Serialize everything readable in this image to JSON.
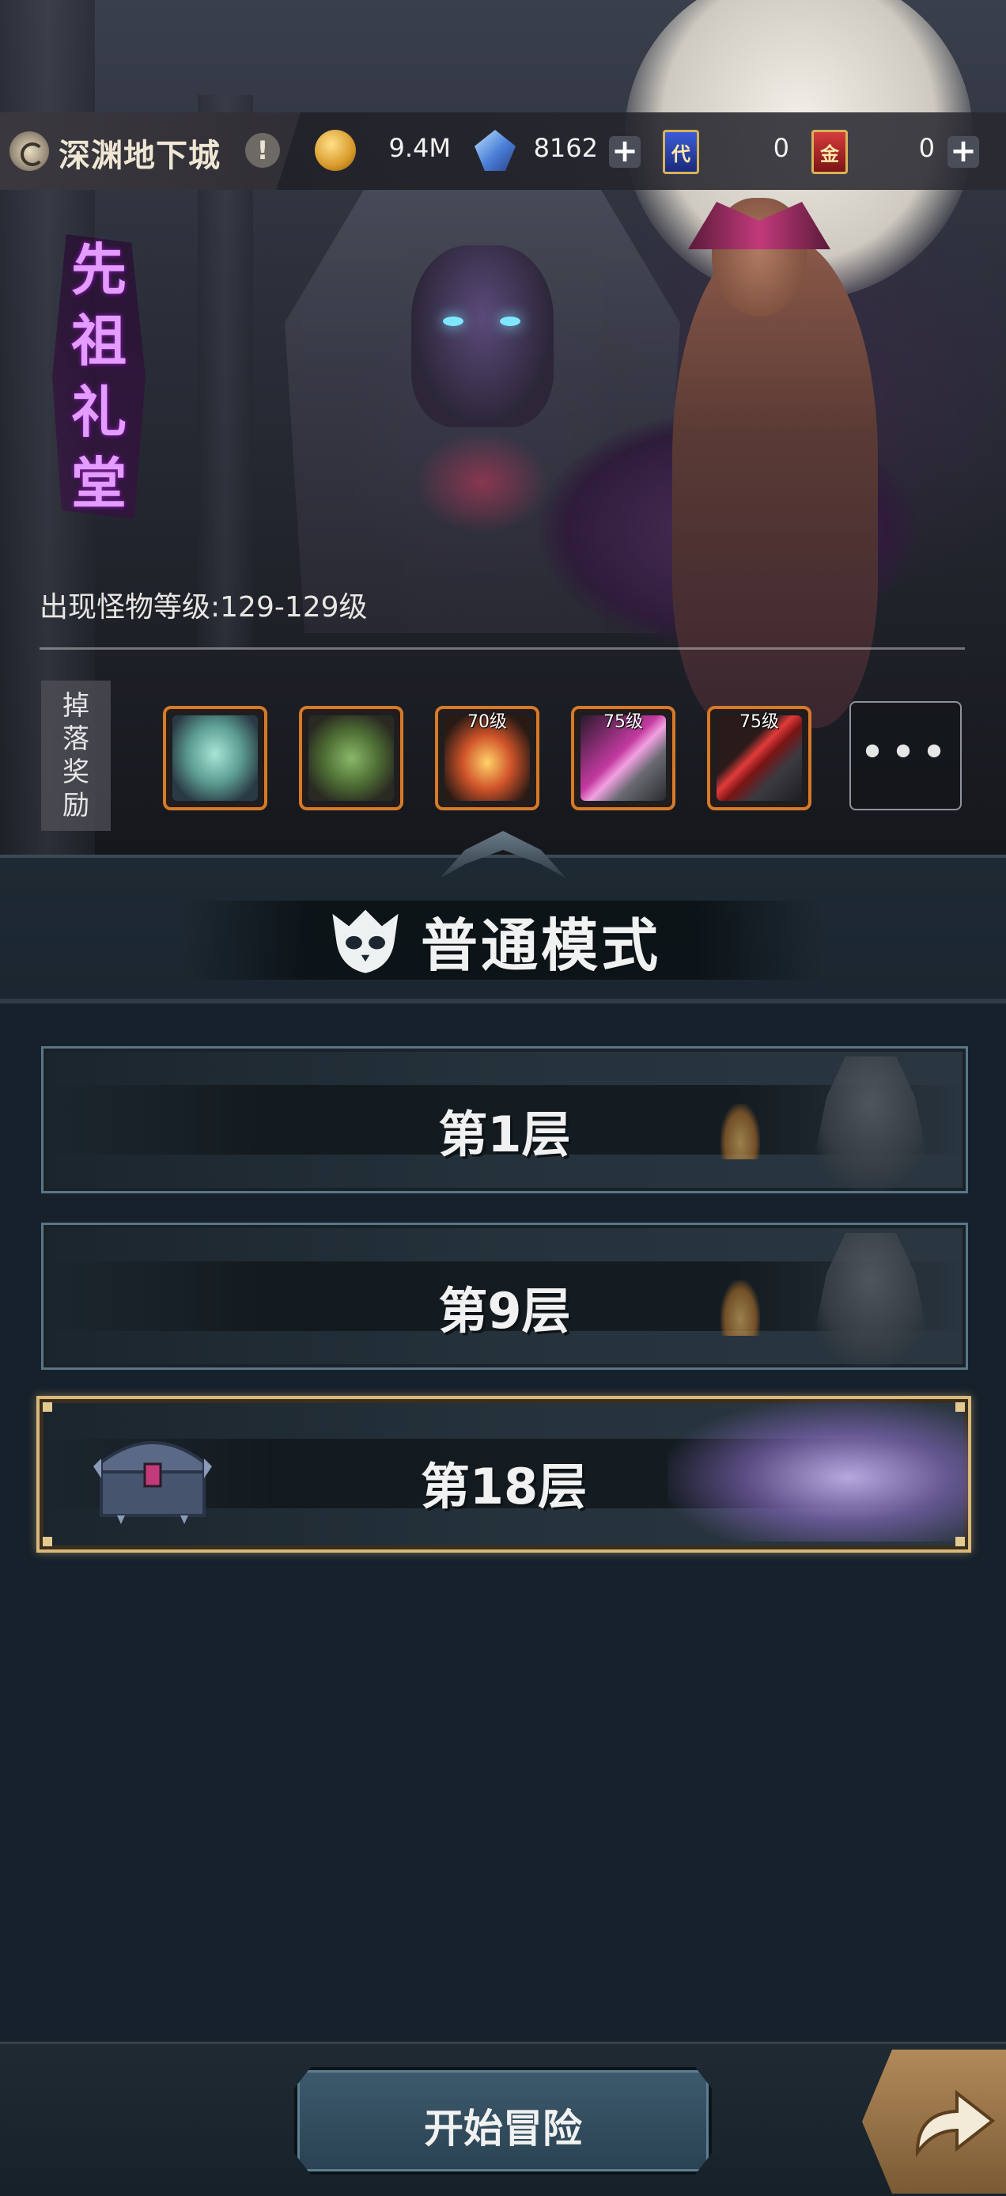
{
  "header": {
    "location_name": "深渊地下城",
    "resources": [
      {
        "icon": "gold-coin-icon",
        "value": "9.4M",
        "has_plus": false
      },
      {
        "icon": "blue-crystal-icon",
        "value": "8162",
        "has_plus": true
      },
      {
        "icon": "blue-ticket-icon",
        "icon_text": "代",
        "value": "0",
        "has_plus": false
      },
      {
        "icon": "red-ticket-icon",
        "icon_text": "金",
        "value": "0",
        "has_plus": true
      }
    ]
  },
  "dungeon": {
    "title_chars": [
      "先",
      "祖",
      "礼",
      "堂"
    ],
    "monster_level": "出现怪物等级:129-129级"
  },
  "drops": {
    "label_chars": [
      "掉",
      "落",
      "奖",
      "励"
    ],
    "items": [
      {
        "icon": "green-elf-portrait-icon",
        "level": ""
      },
      {
        "icon": "horned-goblin-portrait-icon",
        "level": ""
      },
      {
        "icon": "flame-gauntlet-icon",
        "level": "70级"
      },
      {
        "icon": "pink-blade-icon",
        "level": "75级"
      },
      {
        "icon": "red-sword-icon",
        "level": "75级"
      }
    ],
    "more_label": "•••"
  },
  "mode": {
    "title": "普通模式",
    "icon": "skull-mask-icon"
  },
  "floors": [
    {
      "label": "第1层",
      "selected": false
    },
    {
      "label": "第9层",
      "selected": false
    },
    {
      "label": "第18层",
      "selected": true
    }
  ],
  "footer": {
    "start_label": "开始冒险",
    "next_icon": "forward-arrow-icon"
  }
}
